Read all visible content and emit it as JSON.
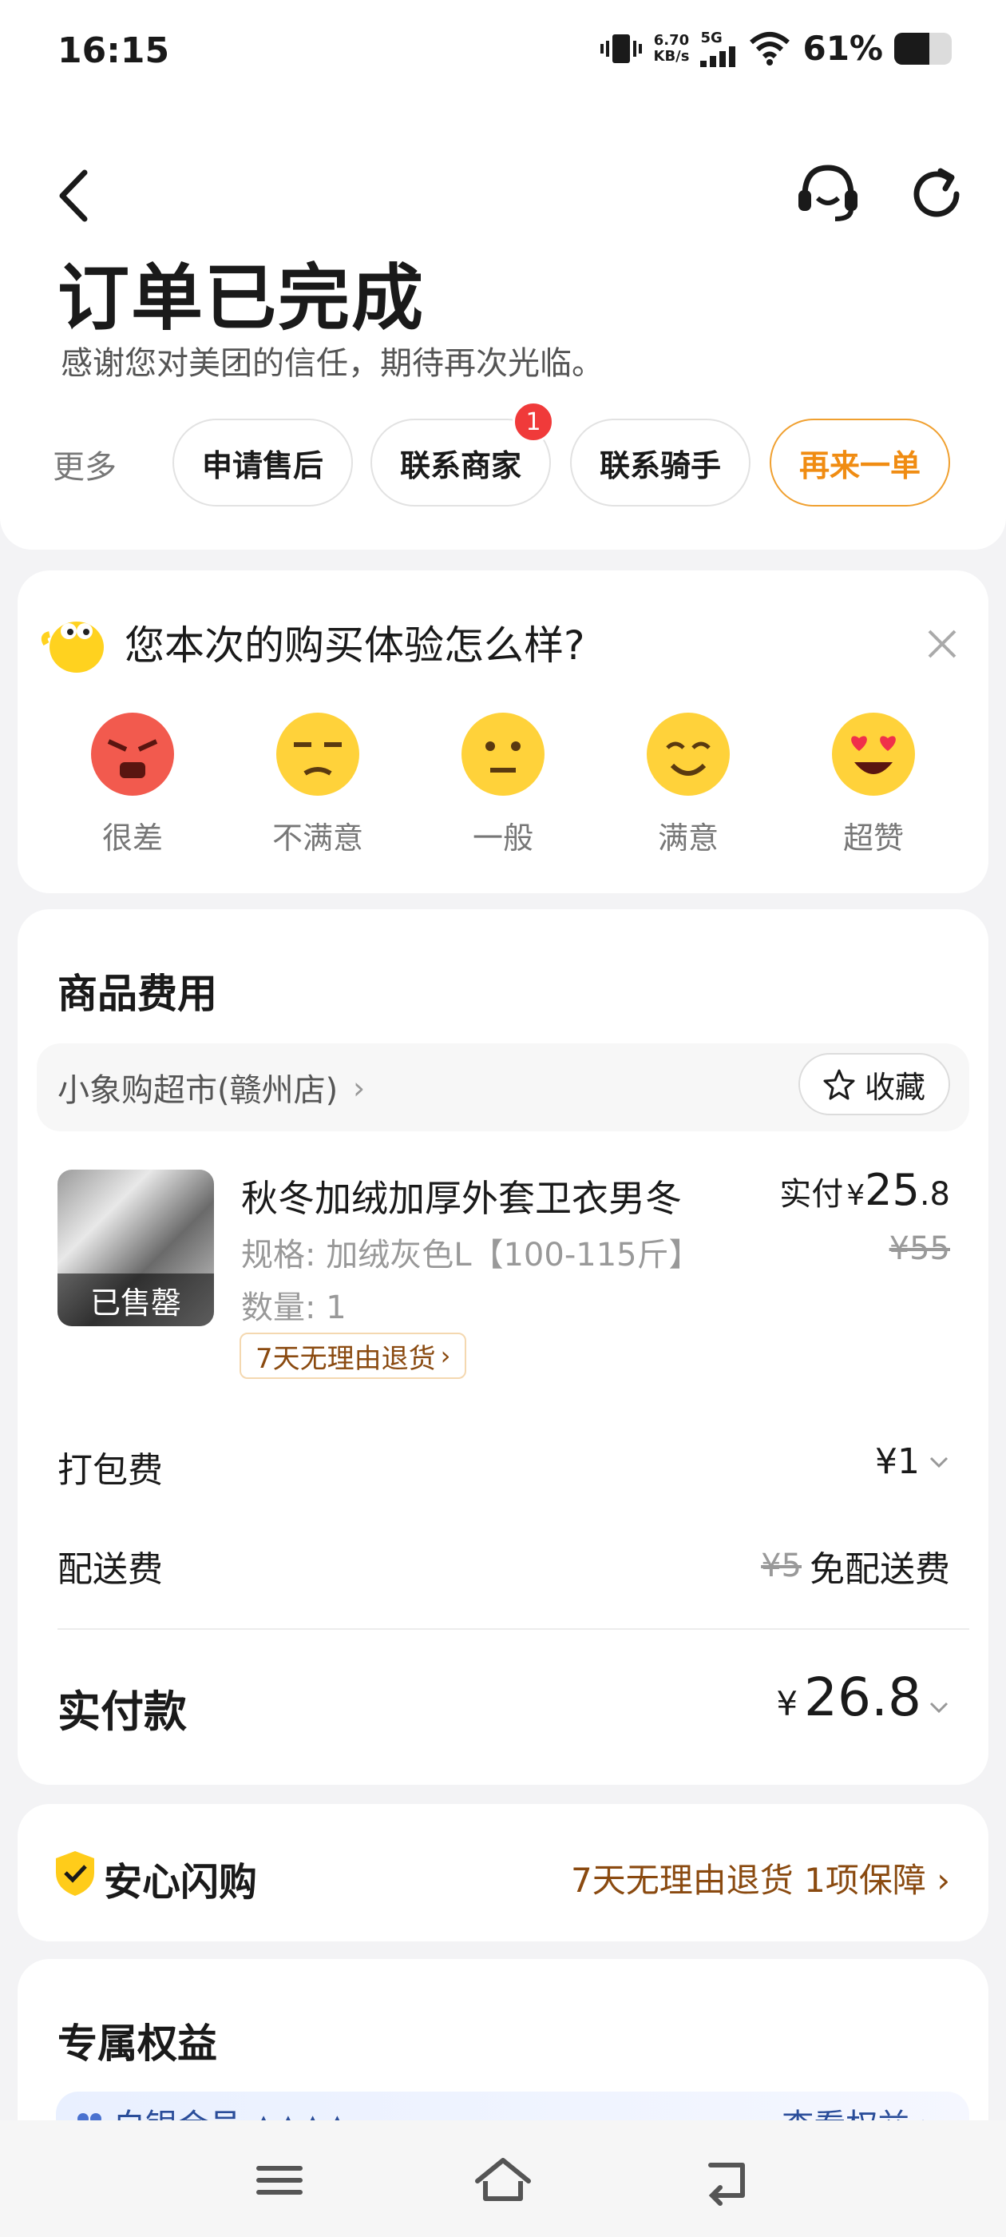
{
  "status_bar": {
    "time": "16:15",
    "speed_value": "6.70",
    "speed_unit": "KB/s",
    "network": "5G",
    "battery_pct": "61%",
    "battery_level": 0.61
  },
  "header": {
    "title": "订单已完成",
    "subtitle": "感谢您对美团的信任，期待再次光临。",
    "more_label": "更多",
    "actions": [
      "申请售后",
      "联系商家",
      "联系骑手",
      "再来一单"
    ],
    "merchant_badge": "1"
  },
  "survey": {
    "question": "您本次的购买体验怎么样?",
    "options": [
      "很差",
      "不满意",
      "一般",
      "满意",
      "超赞"
    ]
  },
  "goods": {
    "section_title": "商品费用",
    "shop_name": "小象购超市(赣州店)",
    "favorite_label": "收藏",
    "product": {
      "name": "秋冬加绒加厚外套卫衣男冬",
      "spec": "规格: 加绒灰色L【100-115斤】",
      "qty": "数量: 1",
      "sold_out": "已售罄",
      "return_tag": "7天无理由退货",
      "paid_label": "实付",
      "paid_yen": "¥",
      "paid_int": "25",
      "paid_dec": ".8",
      "original_price": "¥55"
    },
    "packing_label": "打包费",
    "packing_value": "¥1",
    "delivery_label": "配送费",
    "delivery_original": "¥5",
    "delivery_value": "免配送费",
    "total_label": "实付款",
    "total_yen": "¥",
    "total_value": "26.8"
  },
  "assurance": {
    "title": "安心闪购",
    "link": "7天无理由退货 1项保障"
  },
  "benefits": {
    "title": "专属权益",
    "member_text": "白银会员 ▲▲▲▲",
    "view_link": "查看权益"
  },
  "colors": {
    "accent_orange": "#f08c12",
    "badge_red": "#f03a3a",
    "brown_link": "#8a4a10"
  }
}
